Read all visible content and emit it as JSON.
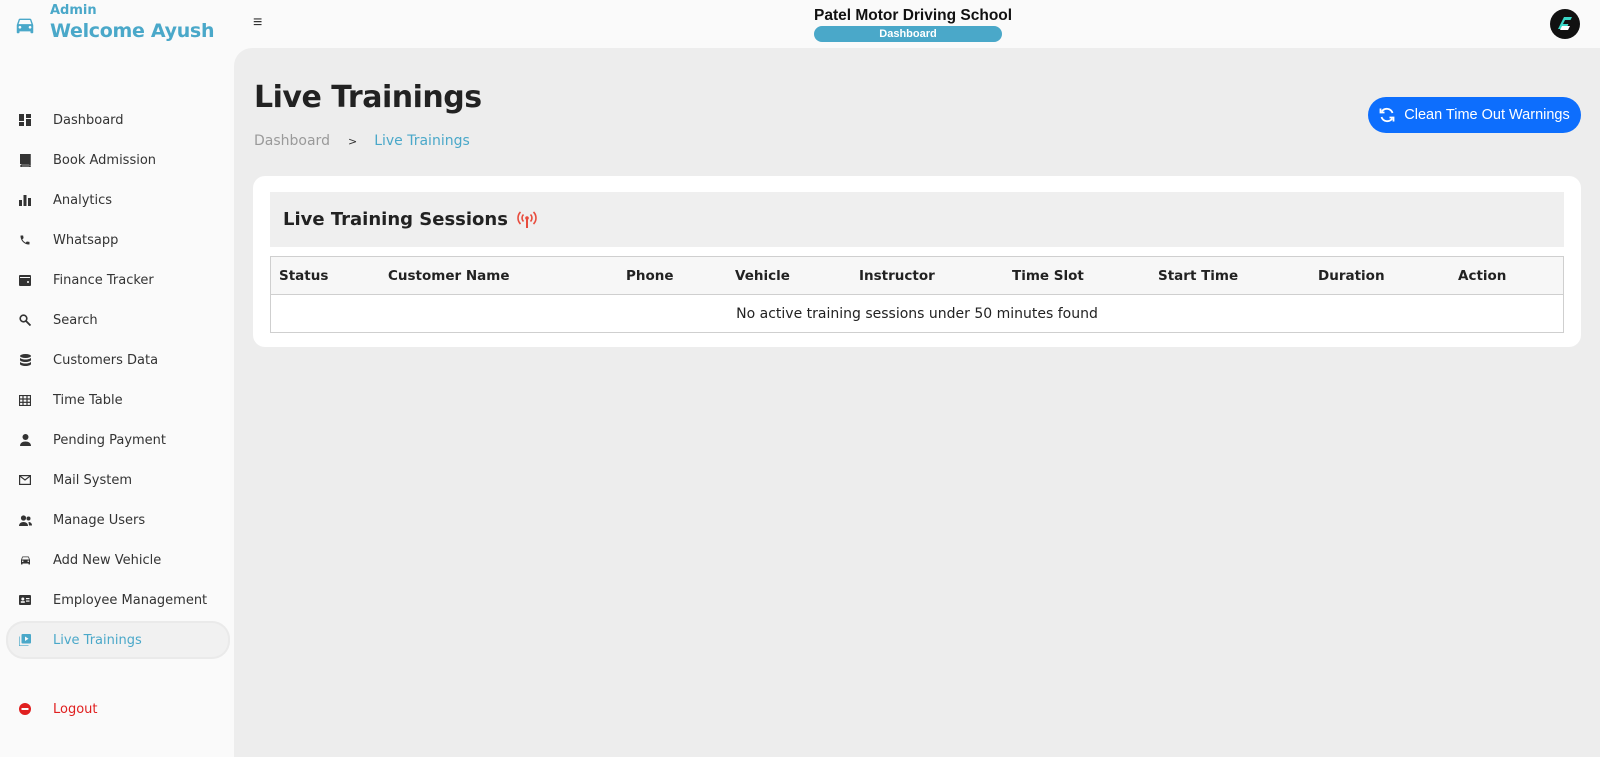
{
  "header": {
    "role": "Admin",
    "welcome": "Welcome Ayush",
    "school_name": "Patel Motor Driving School",
    "section_pill": "Dashboard"
  },
  "sidebar": {
    "items": [
      {
        "label": "Dashboard",
        "icon": "dashboard-icon"
      },
      {
        "label": "Book Admission",
        "icon": "book-icon"
      },
      {
        "label": "Analytics",
        "icon": "bar-chart-icon"
      },
      {
        "label": "Whatsapp",
        "icon": "phone-icon"
      },
      {
        "label": "Finance Tracker",
        "icon": "wallet-icon"
      },
      {
        "label": "Search",
        "icon": "search-icon"
      },
      {
        "label": "Customers Data",
        "icon": "database-icon"
      },
      {
        "label": "Time Table",
        "icon": "table-icon"
      },
      {
        "label": "Pending Payment",
        "icon": "person-icon"
      },
      {
        "label": "Mail System",
        "icon": "mail-icon"
      },
      {
        "label": "Manage Users",
        "icon": "users-icon"
      },
      {
        "label": "Add New Vehicle",
        "icon": "car-icon"
      },
      {
        "label": "Employee Management",
        "icon": "id-card-icon"
      },
      {
        "label": "Live Trainings",
        "icon": "video-library-icon",
        "active": true
      }
    ],
    "logout": "Logout"
  },
  "main": {
    "title": "Live Trainings",
    "breadcrumb": {
      "home": "Dashboard",
      "separator": ">",
      "current": "Live Trainings"
    },
    "clean_button": "Clean Time Out Warnings",
    "card": {
      "title": "Live Training Sessions",
      "columns": [
        "Status",
        "Customer Name",
        "Phone",
        "Vehicle",
        "Instructor",
        "Time Slot",
        "Start Time",
        "Duration",
        "Action"
      ],
      "empty_message": "No active training sessions under 50 minutes found"
    }
  },
  "colors": {
    "accent": "#4aa8c9",
    "primary_button": "#0d6efd",
    "logout": "#e01f1f",
    "live_signal": "#e84c3d"
  }
}
